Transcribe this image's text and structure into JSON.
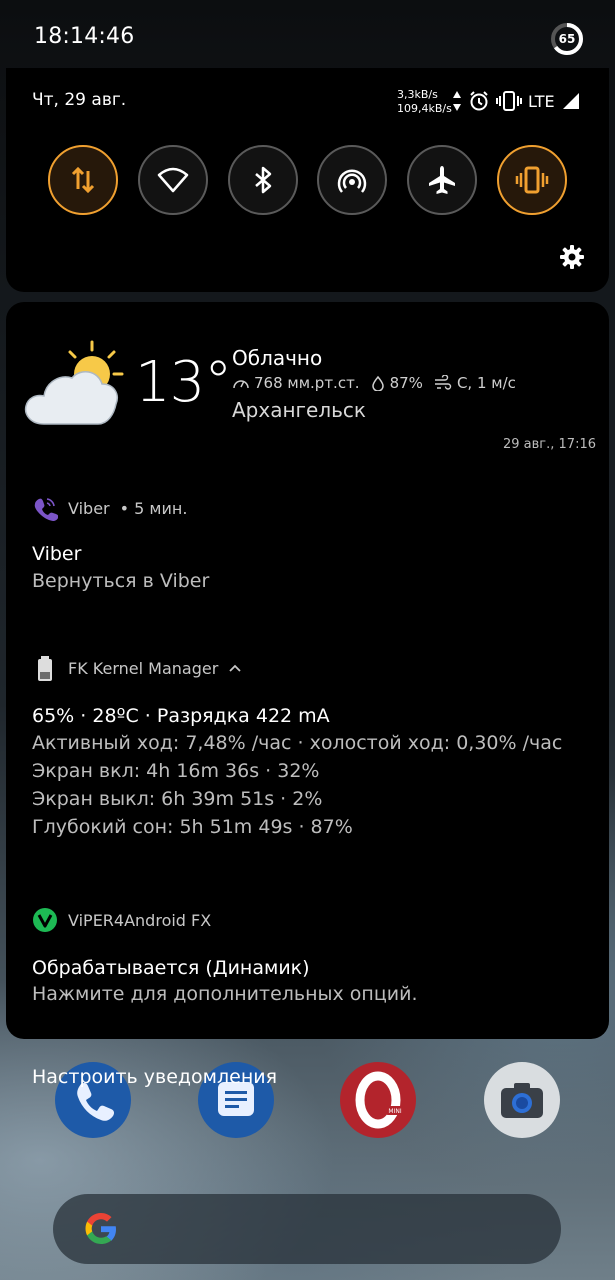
{
  "status_bar": {
    "time": "18:14:46",
    "battery_level": "65"
  },
  "quick_settings": {
    "date": "Чт, 29 авг.",
    "upload_speed": "3,3kB/s",
    "download_speed": "109,4kB/s",
    "network_type": "LTE",
    "tiles": [
      {
        "name": "mobile-data",
        "icon": "data-arrows-icon",
        "active": true
      },
      {
        "name": "wifi",
        "icon": "wifi-icon",
        "active": false
      },
      {
        "name": "bluetooth",
        "icon": "bluetooth-icon",
        "active": false
      },
      {
        "name": "hotspot",
        "icon": "hotspot-icon",
        "active": false
      },
      {
        "name": "airplane-mode",
        "icon": "airplane-icon",
        "active": false
      },
      {
        "name": "vibrate",
        "icon": "vibrate-icon",
        "active": true
      }
    ],
    "accent_color": "#f0a030"
  },
  "weather": {
    "temperature": "13°",
    "condition": "Облачно",
    "pressure": "768 мм.рт.ст.",
    "humidity": "87%",
    "wind": "С, 1 м/с",
    "city": "Архангельск",
    "updated": "29 авг., 17:16"
  },
  "notifications": [
    {
      "app": "Viber",
      "meta": "• 5 мин.",
      "title": "Viber",
      "text": "Вернуться в Viber"
    },
    {
      "app": "FK Kernel Manager",
      "expand_icon": "chevron-up-icon",
      "title": "65% · 28ºC · Разрядка 422 mA",
      "lines": [
        "Активный ход: 7,48% /час · холостой ход: 0,30% /час",
        "Экран вкл: 4h 16m 36s  · 32%",
        "Экран выкл: 6h 39m 51s  · 2%",
        "Глубокий сон: 5h 51m 49s  · 87%"
      ]
    },
    {
      "app": "ViPER4Android FX",
      "title": "Обрабатывается (Динамик)",
      "text": "Нажмите для дополнительных опций."
    }
  ],
  "footer": {
    "manage_label": "Настроить уведомления"
  }
}
